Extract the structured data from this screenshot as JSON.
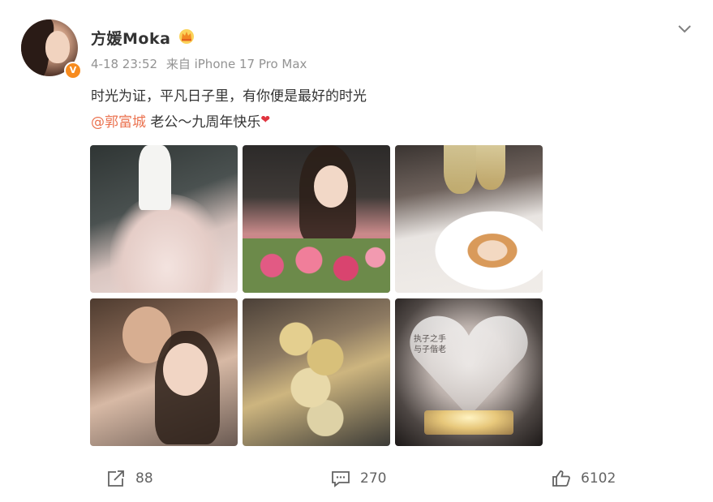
{
  "post": {
    "author": {
      "name": "方媛Moka",
      "verified_badge": "V",
      "crown_icon": "crown-icon"
    },
    "meta": {
      "time": "4-18 23:52",
      "source": "来自 iPhone 17 Pro Max"
    },
    "content": {
      "line1": "时光为证，平凡日子里，有你便是最好的时光",
      "mention": "@郭富城",
      "line2_text": " 老公～九周年快乐",
      "heart": "❤"
    },
    "photos": [
      {
        "desc": "wedding-photo"
      },
      {
        "desc": "flowers-photo"
      },
      {
        "desc": "dessert-plate-photo"
      },
      {
        "desc": "couple-selfie-photo"
      },
      {
        "desc": "toast-glasses-photo"
      },
      {
        "desc": "crystal-heart-photo",
        "engraving": "执子之手 与子偕老"
      }
    ],
    "actions": {
      "repost_count": "88",
      "comment_count": "270",
      "like_count": "6102"
    }
  },
  "colors": {
    "text": "#333333",
    "meta": "#939393",
    "mention": "#eb7350",
    "badge": "#f78b1e",
    "icon": "#636363"
  }
}
